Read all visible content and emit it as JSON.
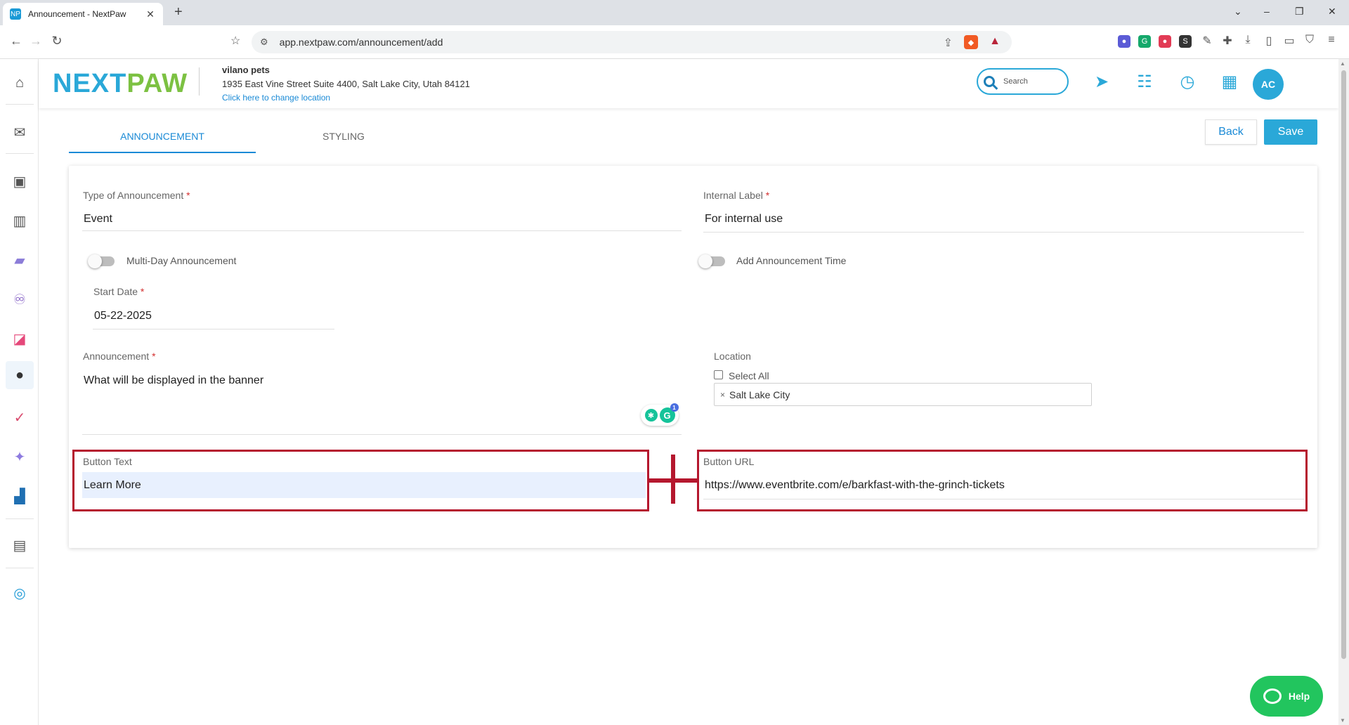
{
  "browser": {
    "tab_title": "Announcement - NextPaw",
    "tab_favicon": "NP",
    "new_tab_glyph": "+",
    "url": "app.nextpaw.com/announcement/add",
    "window_controls": [
      "⌄",
      "–",
      "❐",
      "✕"
    ]
  },
  "header": {
    "logo_left": "NEXT",
    "logo_right": "PAW",
    "business_name": "vilano pets",
    "business_address": "1935 East Vine Street Suite 4400, Salt Lake City, Utah 84121",
    "change_location_link": "Click here to change location",
    "search_placeholder": "Search",
    "avatar_initials": "AC"
  },
  "tabs": [
    {
      "label": "ANNOUNCEMENT",
      "active": true
    },
    {
      "label": "STYLING",
      "active": false
    }
  ],
  "actions": {
    "back_label": "Back",
    "save_label": "Save"
  },
  "form": {
    "type_label": "Type of Announcement",
    "type_value": "Event",
    "internal_label": "Internal Label",
    "internal_value": "For internal use",
    "multi_day_label": "Multi-Day Announcement",
    "multi_day_on": false,
    "add_time_label": "Add Announcement Time",
    "add_time_on": false,
    "start_date_label": "Start Date",
    "start_date_value": "05-22-2025",
    "announcement_label": "Announcement",
    "announcement_value": "What will be displayed in the banner",
    "location_label": "Location",
    "select_all_label": "Select All",
    "location_chip": "Salt Lake City",
    "button_text_label": "Button Text",
    "button_text_value": "Learn More",
    "button_url_label": "Button URL",
    "button_url_value": "https://www.eventbrite.com/e/barkfast-with-the-grinch-tickets",
    "required_mark": "*"
  },
  "grammarly": {
    "badge_count": "1",
    "logo_letter": "G"
  },
  "help": {
    "label": "Help"
  },
  "colors": {
    "accent": "#2aa8d8",
    "brand_green": "#7cc142",
    "annotation": "#b5172e",
    "help_green": "#22c55e"
  }
}
